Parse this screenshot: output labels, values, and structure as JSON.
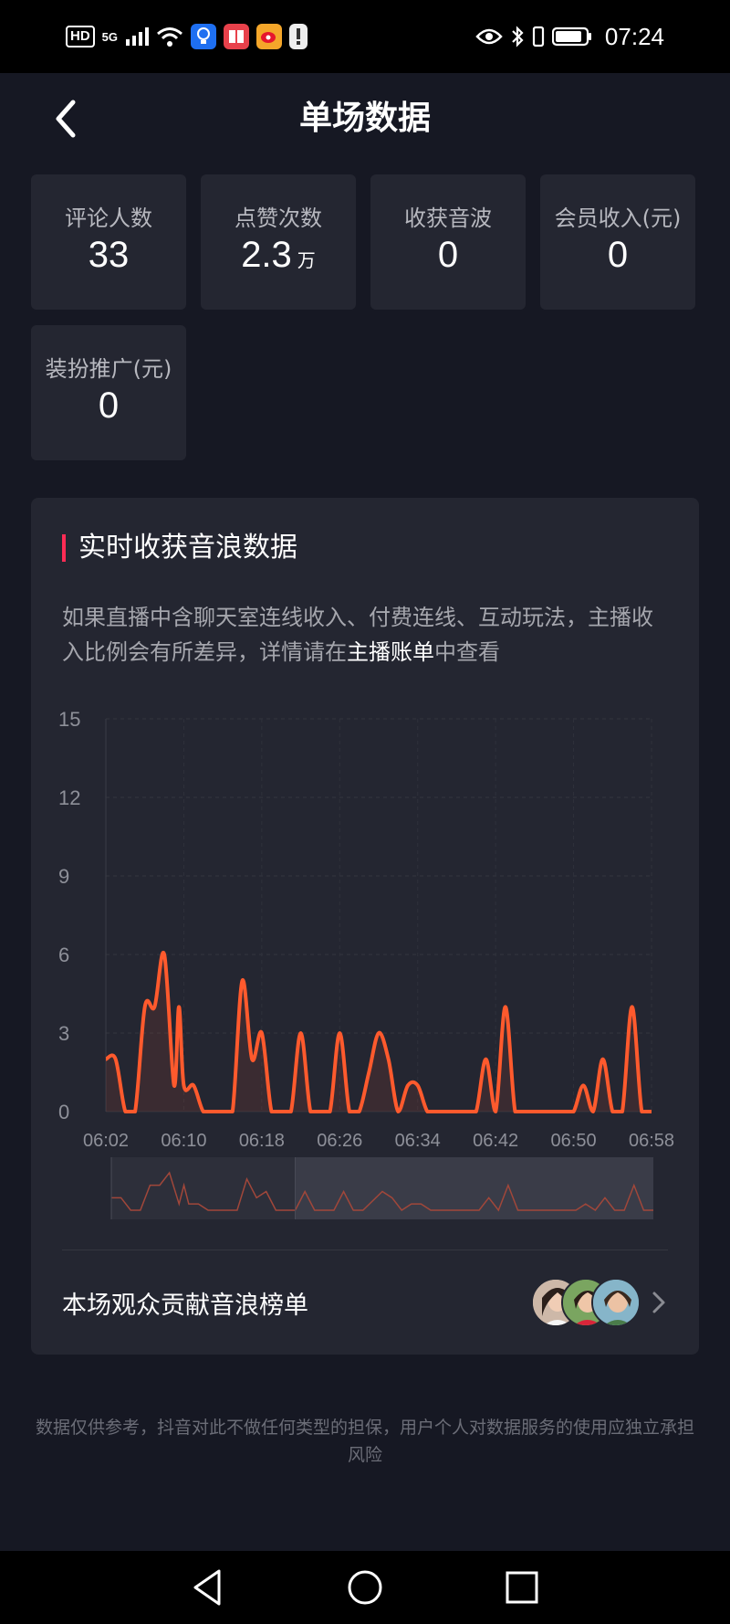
{
  "status_bar": {
    "hd": "HD",
    "network": "5G",
    "time": "07:24"
  },
  "header": {
    "title": "单场数据"
  },
  "stats": [
    {
      "label": "评论人数",
      "value": "33",
      "unit": ""
    },
    {
      "label": "点赞次数",
      "value": "2.3",
      "unit": "万"
    },
    {
      "label": "收获音波",
      "value": "0",
      "unit": ""
    },
    {
      "label": "会员收入(元)",
      "value": "0",
      "unit": ""
    },
    {
      "label": "装扮推广(元)",
      "value": "0",
      "unit": ""
    }
  ],
  "panel": {
    "title": "实时收获音浪数据",
    "notice_prefix": "如果直播中含聊天室连线收入、付费连线、互动玩法，主播收入比例会有所差异，详情请在",
    "notice_link": "主播账单",
    "notice_suffix": "中查看"
  },
  "chart_data": {
    "type": "line",
    "ylim": [
      0,
      15
    ],
    "y_ticks": [
      "15",
      "12",
      "9",
      "6",
      "3",
      "0"
    ],
    "x_ticks": [
      "06:02",
      "06:10",
      "06:18",
      "06:26",
      "06:34",
      "06:42",
      "06:50",
      "06:58"
    ],
    "x_range": [
      "06:02",
      "06:58"
    ],
    "line_color": "#ff5a2d",
    "grid": true,
    "range_selector": {
      "selected_start": "06:02",
      "selected_end": "06:21"
    },
    "series": [
      {
        "x": [
          "06:02",
          "06:03",
          "06:04",
          "06:05",
          "06:06",
          "06:07",
          "06:08",
          "06:09",
          "06:09.5",
          "06:10",
          "06:11",
          "06:12",
          "06:13",
          "06:14",
          "06:15",
          "06:16",
          "06:17",
          "06:18",
          "06:19",
          "06:20",
          "06:21",
          "06:22",
          "06:23",
          "06:24",
          "06:25",
          "06:26",
          "06:27",
          "06:28",
          "06:29",
          "06:30",
          "06:31",
          "06:32",
          "06:33",
          "06:34",
          "06:35",
          "06:36",
          "06:37",
          "06:38",
          "06:39",
          "06:40",
          "06:41",
          "06:42",
          "06:43",
          "06:44",
          "06:45",
          "06:46",
          "06:47",
          "06:48",
          "06:49",
          "06:50",
          "06:51",
          "06:52",
          "06:53",
          "06:54",
          "06:55",
          "06:56",
          "06:57",
          "06:58"
        ],
        "values": [
          2,
          2,
          0,
          0,
          4,
          4,
          6,
          1,
          4,
          1,
          1,
          0,
          0,
          0,
          0,
          5,
          2,
          3,
          0,
          0,
          0,
          3,
          0,
          0,
          0,
          3,
          0,
          0,
          1.5,
          3,
          2,
          0,
          1,
          1,
          0,
          0,
          0,
          0,
          0,
          0,
          2,
          0,
          4,
          0,
          0,
          0,
          0,
          0,
          0,
          0,
          1,
          0,
          2,
          0,
          0,
          4,
          0,
          0
        ]
      }
    ]
  },
  "leaderboard": {
    "label": "本场观众贡献音浪榜单"
  },
  "disclaimer": "数据仅供参考，抖音对此不做任何类型的担保，用户个人对数据服务的使用应独立承担风险"
}
